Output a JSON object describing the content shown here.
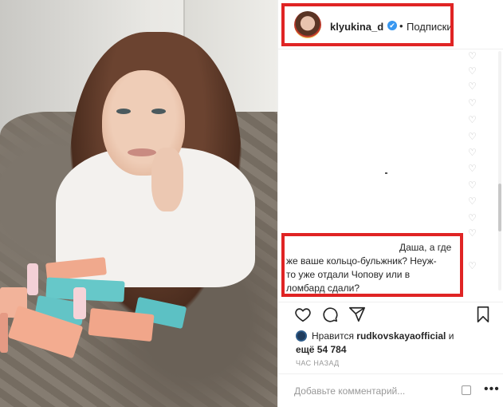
{
  "post": {
    "username": "klyukina_d",
    "verified_symbol": "✔",
    "separator": "•",
    "follow_label": "Подписки"
  },
  "comment": {
    "line1": "Даша, а где",
    "line2": "же ваше кольцо-бульжник? Неуж-",
    "line3": "то уже отдали Чопову или в",
    "line4": "ломбард сдали?"
  },
  "likes": {
    "prefix": "Нравится",
    "liker": "rudkovskayaofficial",
    "middle": "и",
    "more": "ещё 54 784"
  },
  "timestamp": "ЧАС НАЗАД",
  "add_comment": {
    "placeholder": "Добавьте комментарий...",
    "more_glyph": "•••"
  },
  "icons": {
    "heart": "heart-icon",
    "comment": "comment-icon",
    "share": "share-icon",
    "bookmark": "bookmark-icon"
  },
  "colors": {
    "highlight": "#e02424",
    "verified": "#3897f0"
  }
}
